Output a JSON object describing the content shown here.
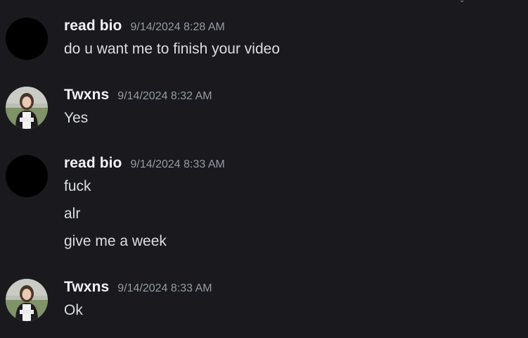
{
  "theme": {
    "background": "#1a1a1e",
    "username_color": "#f2f3f5",
    "timestamp_color": "#949ba4",
    "text_color": "#dbdee1"
  },
  "messages": [
    {
      "author": "read bio",
      "timestamp": "9/14/2024 8:28 AM",
      "avatar": "dark-circle-avatar",
      "lines": [
        "do u want me to finish your video"
      ]
    },
    {
      "author": "Twxns",
      "timestamp": "9/14/2024 8:32 AM",
      "avatar": "photo-avatar",
      "lines": [
        "Yes"
      ]
    },
    {
      "author": "read bio",
      "timestamp": "9/14/2024 8:33 AM",
      "avatar": "dark-circle-avatar",
      "lines": [
        "fuck",
        "alr",
        "give me a week"
      ]
    },
    {
      "author": "Twxns",
      "timestamp": "9/14/2024 8:33 AM",
      "avatar": "photo-avatar",
      "lines": [
        "Ok"
      ]
    }
  ]
}
